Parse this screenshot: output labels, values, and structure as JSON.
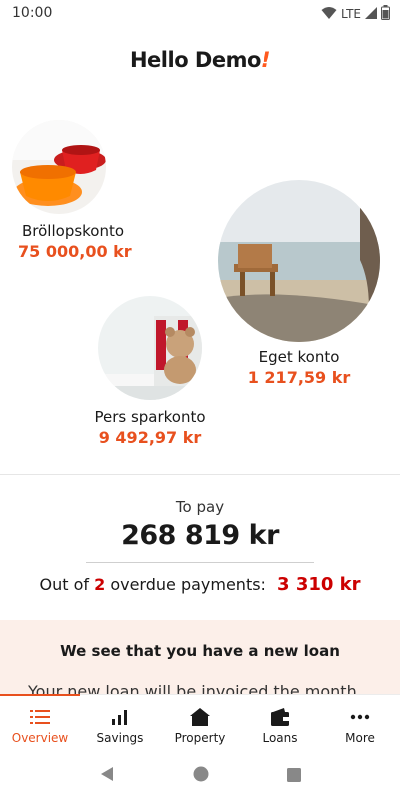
{
  "status_bar": {
    "time": "10:00",
    "network": "LTE"
  },
  "header": {
    "greeting": "Hello Demo",
    "exclamation": "!"
  },
  "accounts": [
    {
      "name": "Bröllopskonto",
      "amount": "75 000,00 kr"
    },
    {
      "name": "Eget konto",
      "amount": "1 217,59 kr"
    },
    {
      "name": "Pers sparkonto",
      "amount": "9 492,97 kr"
    }
  ],
  "payments": {
    "to_pay_label": "To pay",
    "to_pay_amount": "268 819 kr",
    "overdue_prefix": "Out of",
    "overdue_count": "2",
    "overdue_suffix": "overdue payments:",
    "overdue_amount": "3 310 kr"
  },
  "loan_banner": {
    "title": "We see that you have a new loan",
    "text": "Your new loan will be invoiced the month"
  },
  "bottom_nav": [
    {
      "label": "Overview",
      "icon": "list-icon",
      "active": true
    },
    {
      "label": "Savings",
      "icon": "bar-chart-icon",
      "active": false
    },
    {
      "label": "Property",
      "icon": "home-icon",
      "active": false
    },
    {
      "label": "Loans",
      "icon": "wallet-icon",
      "active": false
    },
    {
      "label": "More",
      "icon": "more-icon",
      "active": false
    }
  ],
  "colors": {
    "accent": "#e8501e",
    "overdue": "#cc0000",
    "banner": "#fcefe9"
  }
}
